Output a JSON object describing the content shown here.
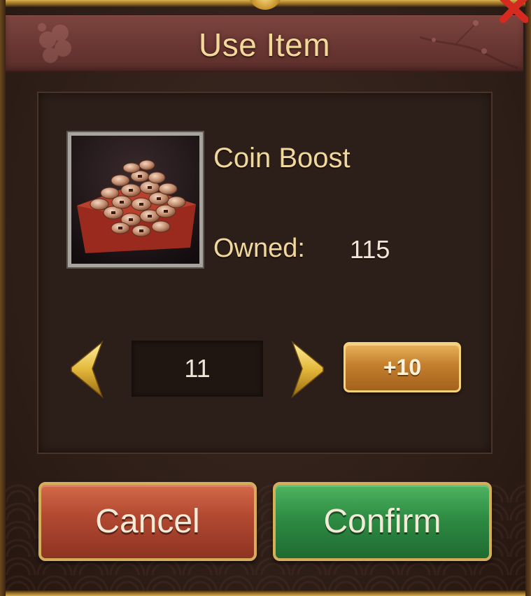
{
  "dialog": {
    "title": "Use Item",
    "accent_color": "#f2d99a"
  },
  "item": {
    "name": "Coin Boost",
    "icon": "coin-pile-icon",
    "owned_label": "Owned:",
    "owned_value": "115"
  },
  "quantity": {
    "value": "11",
    "decrease_icon": "chevron-left-icon",
    "increase_icon": "chevron-right-icon",
    "plus_ten_label": "+10"
  },
  "actions": {
    "cancel_label": "Cancel",
    "confirm_label": "Confirm",
    "cancel_color": "#b44a32",
    "confirm_color": "#2e8c43"
  }
}
